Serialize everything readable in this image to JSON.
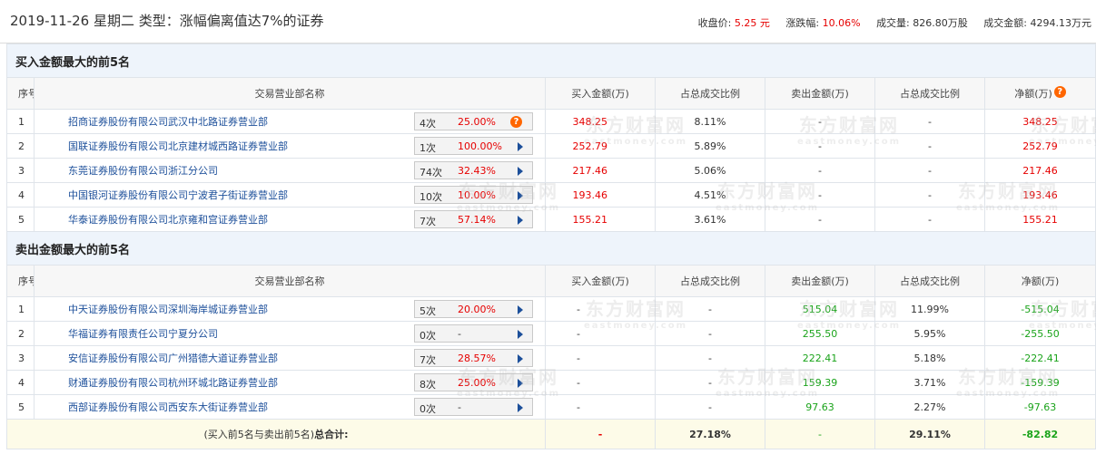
{
  "header": {
    "title": "2019-11-26 星期二  类型：涨幅偏离值达7%的证券",
    "close_label": "收盘价:",
    "close_value": "5.25 元",
    "change_label": "涨跌幅:",
    "change_value": "10.06%",
    "volume_label": "成交量:",
    "volume_value": "826.80万股",
    "amount_label": "成交金额:",
    "amount_value": "4294.13万元"
  },
  "columns": {
    "seq": "序号",
    "name": "交易营业部名称",
    "buy": "买入金额(万)",
    "ratio1": "占总成交比例",
    "sell": "卖出金额(万)",
    "ratio2": "占总成交比例",
    "net": "净额(万)"
  },
  "buy_section": {
    "title": "买入金额最大的前5名",
    "rows": [
      {
        "seq": "1",
        "name": "招商证券股份有限公司武汉中北路证券营业部",
        "count": "4次",
        "pct": "25.00%",
        "buy": "348.25",
        "ratio1": "8.11%",
        "sell": "-",
        "ratio2": "-",
        "net": "348.25"
      },
      {
        "seq": "2",
        "name": "国联证券股份有限公司北京建材城西路证券营业部",
        "count": "1次",
        "pct": "100.00%",
        "buy": "252.79",
        "ratio1": "5.89%",
        "sell": "-",
        "ratio2": "-",
        "net": "252.79"
      },
      {
        "seq": "3",
        "name": "东莞证券股份有限公司浙江分公司",
        "count": "74次",
        "pct": "32.43%",
        "buy": "217.46",
        "ratio1": "5.06%",
        "sell": "-",
        "ratio2": "-",
        "net": "217.46"
      },
      {
        "seq": "4",
        "name": "中国银河证券股份有限公司宁波君子街证券营业部",
        "count": "10次",
        "pct": "10.00%",
        "buy": "193.46",
        "ratio1": "4.51%",
        "sell": "-",
        "ratio2": "-",
        "net": "193.46"
      },
      {
        "seq": "5",
        "name": "华泰证券股份有限公司北京雍和宫证券营业部",
        "count": "7次",
        "pct": "57.14%",
        "buy": "155.21",
        "ratio1": "3.61%",
        "sell": "-",
        "ratio2": "-",
        "net": "155.21"
      }
    ]
  },
  "sell_section": {
    "title": "卖出金额最大的前5名",
    "rows": [
      {
        "seq": "1",
        "name": "中天证券股份有限公司深圳海岸城证券营业部",
        "count": "5次",
        "pct": "20.00%",
        "buy": "-",
        "ratio1": "-",
        "sell": "515.04",
        "ratio2": "11.99%",
        "net": "-515.04"
      },
      {
        "seq": "2",
        "name": "华福证券有限责任公司宁夏分公司",
        "count": "0次",
        "pct": "-",
        "buy": "-",
        "ratio1": "-",
        "sell": "255.50",
        "ratio2": "5.95%",
        "net": "-255.50"
      },
      {
        "seq": "3",
        "name": "安信证券股份有限公司广州猎德大道证券营业部",
        "count": "7次",
        "pct": "28.57%",
        "buy": "-",
        "ratio1": "-",
        "sell": "222.41",
        "ratio2": "5.18%",
        "net": "-222.41"
      },
      {
        "seq": "4",
        "name": "财通证券股份有限公司杭州环城北路证券营业部",
        "count": "8次",
        "pct": "25.00%",
        "buy": "-",
        "ratio1": "-",
        "sell": "159.39",
        "ratio2": "3.71%",
        "net": "-159.39"
      },
      {
        "seq": "5",
        "name": "西部证券股份有限公司西安东大街证券营业部",
        "count": "0次",
        "pct": "-",
        "buy": "-",
        "ratio1": "-",
        "sell": "97.63",
        "ratio2": "2.27%",
        "net": "-97.63"
      }
    ]
  },
  "total": {
    "label_prefix": "(买入前5名与卖出前5名)",
    "label_bold": "总合计:",
    "buy": "-",
    "ratio1": "27.18%",
    "sell": "-",
    "ratio2": "29.11%",
    "net": "-82.82"
  },
  "watermark": {
    "big": "东方财富网",
    "small": "eastmoney.com"
  },
  "help_icon_glyph": "?",
  "colors": {
    "positive": "#e60000",
    "negative": "#1aa31a",
    "link": "#1c4f9a",
    "section_bg": "#eef4fb",
    "total_bg": "#fdfbe8",
    "help_icon": "#ff6600"
  }
}
